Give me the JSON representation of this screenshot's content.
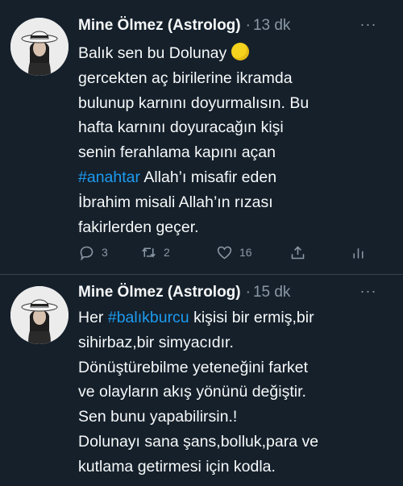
{
  "tweets": [
    {
      "author": "Mine Ölmez (Astrolog)",
      "separator": "·",
      "time": "13 dk",
      "more_label": "···",
      "avatar_icon": "profile-photo-woman-in-hat",
      "lines": {
        "l1": "Balık sen bu Dolunay",
        "l2": "gercekten aç birilerine ikramda",
        "l3": "bulunup karnını doyurmalısın. Bu",
        "l4": "hafta karnını doyuracağın kişi",
        "l5": "senin ferahlama kapını açan",
        "l6_hashtag": "#anahtar",
        "l6_rest": " Allah’ı misafir eden",
        "l7": "İbrahim misali Allah’ın rızası",
        "l8": "fakirlerden geçer."
      },
      "emoji": "full-moon-emoji",
      "actions": {
        "reply_count": "3",
        "retweet_count": "2",
        "like_count": "16"
      }
    },
    {
      "author": "Mine Ölmez (Astrolog)",
      "separator": "·",
      "time": "15 dk",
      "more_label": "···",
      "avatar_icon": "profile-photo-woman-in-hat",
      "lines": {
        "l1_pre": "Her ",
        "l1_hashtag": "#balıkburcu",
        "l1_rest": " kişisi bir ermiş,bir",
        "l2": "sihirbaz,bir simyacıdır.",
        "l3": "Dönüştürebilme yeteneğini farket",
        "l4": "ve olayların akış yönünü değiştir.",
        "l5": "Sen bunu yapabilirsin.!",
        "l6": "Dolunayı sana şans,bolluk,para ve",
        "l7": "kutlama getirmesi için kodla."
      }
    }
  ],
  "colors": {
    "background": "#15202b",
    "text": "#f7f9f9",
    "muted": "#8b98a5",
    "link": "#1d9bf0",
    "divider": "#38444d"
  }
}
